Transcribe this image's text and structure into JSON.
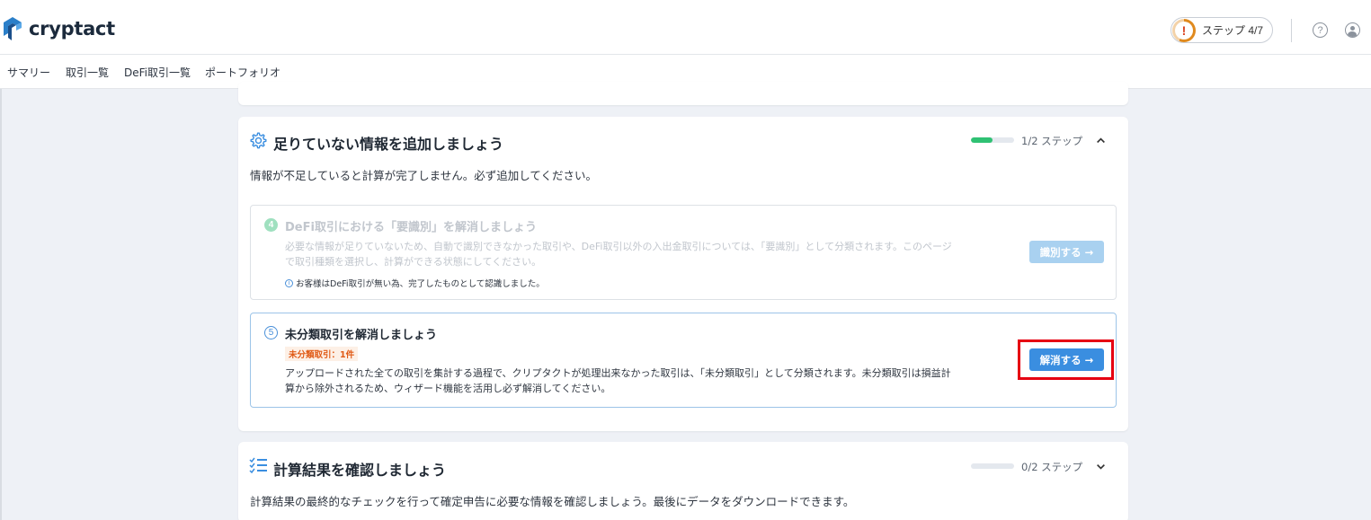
{
  "app": {
    "logo_text": "cryptact"
  },
  "header": {
    "step_label": "ステップ 4/7",
    "step_alert": "!",
    "help_icon_glyph": "?"
  },
  "nav": {
    "items": [
      "サマリー",
      "取引一覧",
      "DeFi取引一覧",
      "ポートフォリオ"
    ]
  },
  "section_missing": {
    "title": "足りていない情報を追加しましょう",
    "description": "情報が不足していると計算が完了しません。必ず追加してください。",
    "progress_label": "1/2 ステップ",
    "progress_fraction": 0.5,
    "tasks": {
      "defi": {
        "number": "4",
        "title": "DeFi取引における「要識別」を解消しましょう",
        "body_line1": "必要な情報が足りていないため、自動で識別できなかった取引や、DeFi取引以外の入出金取引については、「要識別」として分類されます。このページ",
        "body_line2": "で取引種類を選択し、計算ができる状態にしてください。",
        "note_icon_glyph": "i",
        "note": "お客様はDeFi取引が無い為、完了したものとして認識しました。",
        "button": "識別する →"
      },
      "unclassified": {
        "number": "5",
        "title": "未分類取引を解消しましょう",
        "badge": "未分類取引：1件",
        "body_line1": "アップロードされた全ての取引を集計する過程で、クリプタクトが処理出来なかった取引は、「未分類取引」として分類されます。未分類取引は損益計",
        "body_line2": "算から除外されるため、ウィザード機能を活用し必ず解消してください。",
        "button": "解消する →"
      }
    }
  },
  "section_results": {
    "title": "計算結果を確認しましょう",
    "description": "計算結果の最終的なチェックを行って確定申告に必要な情報を確認しましょう。最後にデータをダウンロードできます。",
    "progress_label": "0/2 ステップ",
    "progress_fraction": 0
  },
  "colors": {
    "brand": "#1b2a3c",
    "accent": "#3a8ee0",
    "progress_green": "#2fc173",
    "alert_orange": "#e08a1e",
    "highlight_red": "#e60012"
  },
  "icons": {
    "logo": "cryptact-logo-icon",
    "gear": "gear-icon",
    "checklist": "checklist-icon",
    "help": "help-icon",
    "user": "user-icon",
    "chevron_up": "chevron-up-icon",
    "chevron_down": "chevron-down-icon",
    "info": "info-icon"
  }
}
